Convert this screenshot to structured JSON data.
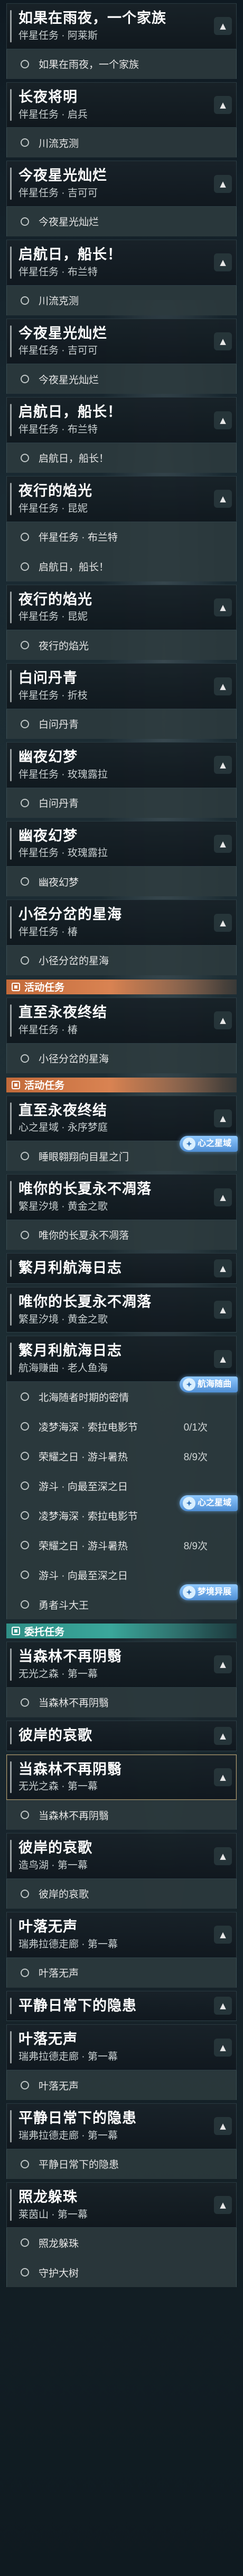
{
  "categories": {
    "event": "活动任务",
    "side": "委托任务"
  },
  "items": [
    {
      "kind": "quest",
      "title": "如果在雨夜，一个家族",
      "meta": "伴星任务 · 阿莱斯"
    },
    {
      "kind": "sub",
      "label": "如果在雨夜，一个家族"
    },
    {
      "kind": "quest",
      "title": "长夜将明",
      "meta": "伴星任务 · 启兵"
    },
    {
      "kind": "sub",
      "label": "川流克测"
    },
    {
      "kind": "quest",
      "title": "今夜星光灿烂",
      "meta": "伴星任务 · 吉可可"
    },
    {
      "kind": "sub",
      "label": "今夜星光灿烂"
    },
    {
      "kind": "quest",
      "title": "启航日，船长！",
      "meta": "伴星任务 · 布兰特"
    },
    {
      "kind": "sub",
      "label": "川流克测"
    },
    {
      "kind": "quest",
      "title": "今夜星光灿烂",
      "meta": "伴星任务 · 吉可可"
    },
    {
      "kind": "sub",
      "label": "今夜星光灿烂"
    },
    {
      "kind": "quest",
      "title": "启航日，船长！",
      "meta": "伴星任务 · 布兰特"
    },
    {
      "kind": "sub",
      "label": "启航日，船长！"
    },
    {
      "kind": "quest",
      "title": "夜行的焰光",
      "meta": "伴星任务 · 昆妮"
    },
    {
      "kind": "sub",
      "label": "伴星任务 · 布兰特"
    },
    {
      "kind": "sub",
      "label": "启航日，船长！"
    },
    {
      "kind": "quest",
      "title": "夜行的焰光",
      "meta": "伴星任务 · 昆妮"
    },
    {
      "kind": "sub",
      "label": "夜行的焰光"
    },
    {
      "kind": "quest",
      "title": "白问丹青",
      "meta": "伴星任务 · 折枝"
    },
    {
      "kind": "sub",
      "label": "白问丹青"
    },
    {
      "kind": "quest",
      "title": "幽夜幻梦",
      "meta": "伴星任务 · 玫瑰露拉"
    },
    {
      "kind": "sub",
      "label": "白问丹青"
    },
    {
      "kind": "quest",
      "title": "幽夜幻梦",
      "meta": "伴星任务 · 玫瑰露拉"
    },
    {
      "kind": "sub",
      "label": "幽夜幻梦"
    },
    {
      "kind": "quest",
      "title": "小径分岔的星海",
      "meta": "伴星任务 · 椿"
    },
    {
      "kind": "sub",
      "label": "小径分岔的星海"
    },
    {
      "kind": "category",
      "style": "event",
      "label": "活动任务"
    },
    {
      "kind": "quest",
      "title": "直至永夜终结",
      "meta": "伴星任务 · 椿"
    },
    {
      "kind": "sub",
      "label": "小径分岔的星海"
    },
    {
      "kind": "category",
      "style": "event",
      "label": "活动任务"
    },
    {
      "kind": "quest",
      "title": "直至永夜终结",
      "meta": "心之星域 · 永序梦庭"
    },
    {
      "kind": "sub",
      "label": "睡眼翱翔向目星之门",
      "badge": "心之星域"
    },
    {
      "kind": "quest",
      "title": "唯你的长夏永不凋落",
      "meta": "繁星汐境 · 黄金之歌"
    },
    {
      "kind": "sub",
      "label": "唯你的长夏永不凋落"
    },
    {
      "kind": "quest",
      "title": "繁月利航海日志",
      "meta": ""
    },
    {
      "kind": "quest",
      "title": "唯你的长夏永不凋落",
      "meta": "繁星汐境 · 黄金之歌"
    },
    {
      "kind": "quest",
      "title": "繁月利航海日志",
      "meta": "航海赚曲 · 老人鱼海"
    },
    {
      "kind": "sub",
      "label": "北海随者时期的密情",
      "badge": "航海随曲"
    },
    {
      "kind": "sub",
      "label": "凌梦海深 · 索拉电影节",
      "extra": "0/1次"
    },
    {
      "kind": "sub",
      "label": "荣耀之日 · 游斗暑热",
      "extra": "8/9次"
    },
    {
      "kind": "sub",
      "label": "游斗 · 向最至深之日"
    },
    {
      "kind": "sub",
      "label": "凌梦海深 · 索拉电影节",
      "badge": "心之星域"
    },
    {
      "kind": "sub",
      "label": "荣耀之日 · 游斗暑热",
      "extra": "8/9次"
    },
    {
      "kind": "sub",
      "label": "游斗 · 向最至深之日"
    },
    {
      "kind": "sub",
      "label": "勇者斗大王",
      "badge": "梦境异展"
    },
    {
      "kind": "category",
      "style": "side",
      "label": "委托任务"
    },
    {
      "kind": "quest",
      "title": "当森林不再阴翳",
      "meta": "无光之森 · 第一幕"
    },
    {
      "kind": "sub",
      "label": "当森林不再阴翳"
    },
    {
      "kind": "quest",
      "title": "彼岸的哀歌",
      "meta": ""
    },
    {
      "kind": "quest",
      "title": "当森林不再阴翳",
      "meta": "无光之森 · 第一幕",
      "active": true
    },
    {
      "kind": "sub",
      "label": "当森林不再阴翳"
    },
    {
      "kind": "quest",
      "title": "彼岸的哀歌",
      "meta": "造鸟湖 · 第一幕"
    },
    {
      "kind": "sub",
      "label": "彼岸的哀歌"
    },
    {
      "kind": "quest",
      "title": "叶落无声",
      "meta": "瑞弗拉德走廊 · 第一幕"
    },
    {
      "kind": "sub",
      "label": "叶落无声"
    },
    {
      "kind": "quest",
      "title": "平静日常下的隐患",
      "meta": ""
    },
    {
      "kind": "quest",
      "title": "叶落无声",
      "meta": "瑞弗拉德走廊 · 第一幕"
    },
    {
      "kind": "sub",
      "label": "叶落无声"
    },
    {
      "kind": "quest",
      "title": "平静日常下的隐患",
      "meta": "瑞弗拉德走廊 · 第一幕"
    },
    {
      "kind": "sub",
      "label": "平静日常下的隐患"
    },
    {
      "kind": "quest",
      "title": "照龙躲珠",
      "meta": "莱茵山 · 第一幕"
    },
    {
      "kind": "sub",
      "label": "照龙躲珠"
    },
    {
      "kind": "sub",
      "label": "守护大树"
    }
  ]
}
